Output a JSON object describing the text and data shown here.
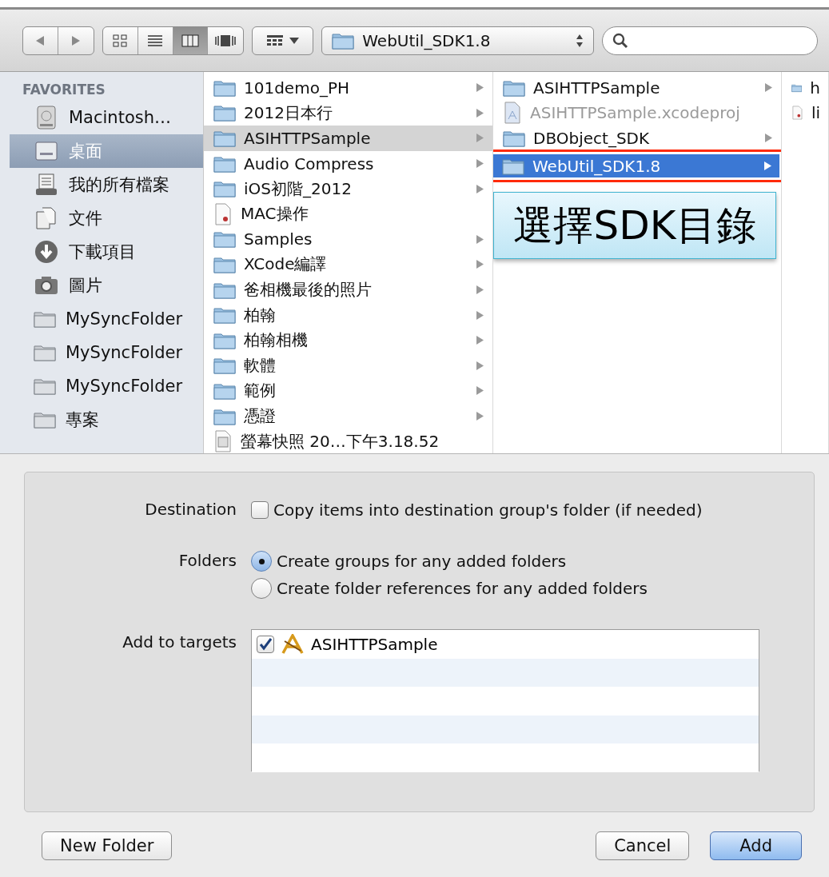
{
  "toolbar": {
    "nav_buttons": [
      {
        "kind": "back"
      },
      {
        "kind": "forward"
      }
    ],
    "view_buttons": [
      {
        "kind": "icons",
        "selected": false
      },
      {
        "kind": "list",
        "selected": false
      },
      {
        "kind": "columns",
        "selected": true
      },
      {
        "kind": "coverflow",
        "selected": false
      }
    ],
    "path_popup": "WebUtil_SDK1.8"
  },
  "sidebar": {
    "heading": "FAVORITES",
    "items": [
      {
        "label": "Macintosh…",
        "kind": "disk",
        "selected": false
      },
      {
        "label": "桌面",
        "kind": "desktop",
        "selected": true
      },
      {
        "label": "我的所有檔案",
        "kind": "all-files",
        "selected": false
      },
      {
        "label": "文件",
        "kind": "documents",
        "selected": false
      },
      {
        "label": "下載項目",
        "kind": "downloads",
        "selected": false
      },
      {
        "label": "圖片",
        "kind": "pictures",
        "selected": false
      },
      {
        "label": "MySyncFolder",
        "kind": "folder",
        "selected": false
      },
      {
        "label": "MySyncFolder",
        "kind": "folder",
        "selected": false
      },
      {
        "label": "MySyncFolder",
        "kind": "folder",
        "selected": false
      },
      {
        "label": "專案",
        "kind": "folder",
        "selected": false
      }
    ]
  },
  "columns": [
    {
      "items": [
        {
          "name": "101demo_PH",
          "kind": "folder",
          "has_children": true,
          "selected": false,
          "disabled": false,
          "highlighted": false
        },
        {
          "name": "2012日本行",
          "kind": "folder",
          "has_children": true,
          "selected": false,
          "disabled": false,
          "highlighted": false
        },
        {
          "name": "ASIHTTPSample",
          "kind": "folder",
          "has_children": true,
          "selected": true,
          "disabled": false,
          "highlighted": false
        },
        {
          "name": "Audio Compress",
          "kind": "folder",
          "has_children": true,
          "selected": false,
          "disabled": false,
          "highlighted": false
        },
        {
          "name": "iOS初階_2012",
          "kind": "folder",
          "has_children": true,
          "selected": false,
          "disabled": false,
          "highlighted": false
        },
        {
          "name": "MAC操作",
          "kind": "document",
          "has_children": false,
          "selected": false,
          "disabled": false,
          "highlighted": false
        },
        {
          "name": "Samples",
          "kind": "folder",
          "has_children": true,
          "selected": false,
          "disabled": false,
          "highlighted": false
        },
        {
          "name": "XCode編譯",
          "kind": "folder",
          "has_children": true,
          "selected": false,
          "disabled": false,
          "highlighted": false
        },
        {
          "name": "爸相機最後的照片",
          "kind": "folder",
          "has_children": true,
          "selected": false,
          "disabled": false,
          "highlighted": false
        },
        {
          "name": "柏翰",
          "kind": "folder",
          "has_children": true,
          "selected": false,
          "disabled": false,
          "highlighted": false
        },
        {
          "name": "柏翰相機",
          "kind": "folder",
          "has_children": true,
          "selected": false,
          "disabled": false,
          "highlighted": false
        },
        {
          "name": "軟體",
          "kind": "folder",
          "has_children": true,
          "selected": false,
          "disabled": false,
          "highlighted": false
        },
        {
          "name": "範例",
          "kind": "folder",
          "has_children": true,
          "selected": false,
          "disabled": false,
          "highlighted": false
        },
        {
          "name": "憑證",
          "kind": "folder",
          "has_children": true,
          "selected": false,
          "disabled": false,
          "highlighted": false
        },
        {
          "name": "螢幕快照 20…下午3.18.52",
          "kind": "image",
          "has_children": false,
          "selected": false,
          "disabled": false,
          "highlighted": false
        }
      ]
    },
    {
      "callout": "選擇SDK目錄",
      "items": [
        {
          "name": "ASIHTTPSample",
          "kind": "folder",
          "has_children": true,
          "selected": false,
          "disabled": false,
          "highlighted": false
        },
        {
          "name": "ASIHTTPSample.xcodeproj",
          "kind": "project",
          "has_children": false,
          "selected": false,
          "disabled": true,
          "highlighted": false
        },
        {
          "name": "DBObject_SDK",
          "kind": "folder",
          "has_children": true,
          "selected": false,
          "disabled": false,
          "highlighted": false
        },
        {
          "name": "WebUtil_SDK1.8",
          "kind": "folder",
          "has_children": true,
          "selected": true,
          "disabled": false,
          "highlighted": true
        }
      ]
    },
    {
      "items": [
        {
          "name": "h",
          "kind": "folder",
          "has_children": false,
          "selected": false,
          "disabled": false,
          "highlighted": false
        },
        {
          "name": "li",
          "kind": "document",
          "has_children": false,
          "selected": false,
          "disabled": false,
          "highlighted": false
        }
      ]
    }
  ],
  "options": {
    "destination": {
      "label": "Destination",
      "option": "Copy items into destination group's folder (if needed)",
      "checked": false
    },
    "folders": {
      "label": "Folders",
      "options": [
        {
          "label": "Create groups for any added folders",
          "selected": true
        },
        {
          "label": "Create folder references for any added folders",
          "selected": false
        }
      ]
    },
    "targets": {
      "label": "Add to targets",
      "rows": [
        {
          "label": "ASIHTTPSample",
          "checked": true
        }
      ]
    }
  },
  "buttons": {
    "new_folder": "New Folder",
    "cancel": "Cancel",
    "add": "Add"
  }
}
